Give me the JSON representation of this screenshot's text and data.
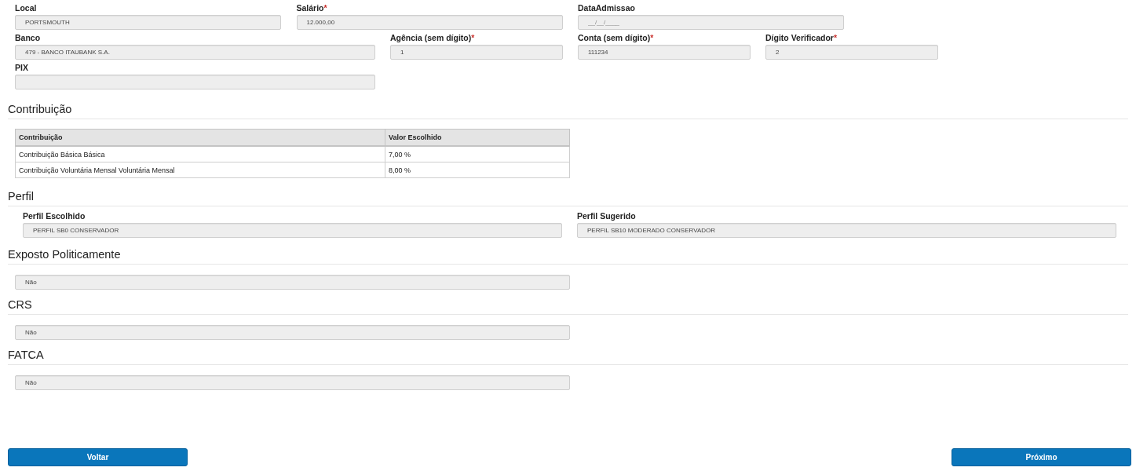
{
  "fields": [
    {
      "label": "Local",
      "value": "PORTSMOUTH"
    },
    {
      "label": "Salário",
      "mark": "*",
      "value": "12.000,00"
    },
    {
      "label": "DataAdmissao",
      "placeholder": "__/__/____"
    },
    {
      "label": "Banco",
      "value": "479 - BANCO ITAUBANK S.A."
    },
    {
      "label": "Agência (sem dígito)",
      "mark": "*",
      "value": "1"
    },
    {
      "label": "Conta (sem dígito)",
      "mark": "*",
      "value": "111234"
    },
    {
      "label": "Dígito Verificador",
      "mark": "*",
      "value": "2"
    },
    {
      "label": "PIX"
    }
  ],
  "contribution": {
    "title": "Contribuição",
    "columns": [
      "Contribuição",
      "Valor Escolhido"
    ],
    "rows": [
      [
        "Contribuição Básica Básica",
        "7,00 %"
      ],
      [
        "Contribuição Voluntária Mensal Voluntária Mensal",
        "8,00 %"
      ]
    ]
  },
  "profile": {
    "title": "Perfil",
    "fields": [
      {
        "label": "Perfil Escolhido",
        "value": "PERFIL SB0 CONSERVADOR"
      },
      {
        "label": "Perfil Sugerido",
        "value": "PERFIL SB10 MODERADO CONSERVADOR"
      }
    ]
  },
  "questions": [
    {
      "title": "Exposto Politicamente",
      "value": "Não"
    },
    {
      "title": "CRS",
      "value": "Não"
    },
    {
      "title": "FATCA",
      "value": "Não"
    }
  ],
  "buttons": {
    "back": "Voltar",
    "next": "Próximo"
  }
}
